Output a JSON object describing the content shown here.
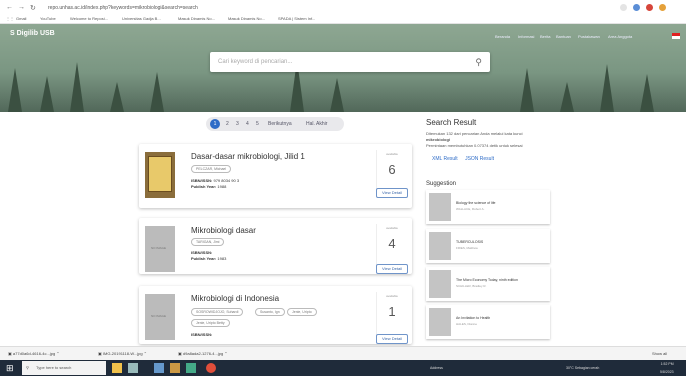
{
  "browser": {
    "url": "repo.unhas.ac.id/index.php?keywords=mikrobiologi&search=search",
    "bookmarks": [
      "Gmail",
      "YouTube",
      "Welcome to Reposi...",
      "Universitas Gadja B...",
      "Masuk Dinamis No...",
      "Masuk Dinamis No...",
      "SPADA | Sistem Inf..."
    ]
  },
  "site": {
    "logo": "Digilib USB",
    "nav": [
      "Beranda",
      "Informasi",
      "Berita",
      "Bantuan",
      "Pustakawan",
      "Area Anggota"
    ],
    "search_placeholder": "Cari keyword di pencarian..."
  },
  "pagination": {
    "pages": [
      "1",
      "2",
      "3",
      "4",
      "5"
    ],
    "next_label": "Berikutnya",
    "last_label": "Hal. Akhir"
  },
  "results": [
    {
      "title": "Dasar-dasar mikrobiologi, Jilid 1",
      "authors": [
        "PELCZAR, Michael"
      ],
      "isbn_label": "ISBN/ISSN:",
      "isbn": "979 8034 90 3",
      "year_label": "Publish Year:",
      "year": "1988",
      "count_label": "available",
      "count": "6",
      "detail_label": "View Detail"
    },
    {
      "title": "Mikrobiologi dasar",
      "authors": [
        "TARIGAN, Jimi"
      ],
      "isbn_label": "ISBN/ISSN:",
      "isbn": "",
      "year_label": "Publish Year:",
      "year": "1983",
      "count_label": "available",
      "count": "4",
      "detail_label": "View Detail"
    },
    {
      "title": "Mikrobiologi di Indonesia",
      "authors": [
        "SOSROWIDJOJO, Suhardi",
        "Susanto, Ign",
        "Jenie, Uripto",
        "Jenie, Uripto Betty"
      ],
      "isbn_label": "ISBN/ISSN:",
      "isbn": "",
      "year_label": "",
      "year": "",
      "count_label": "available",
      "count": "1",
      "detail_label": "View Detail"
    }
  ],
  "sidebar": {
    "result_heading": "Search Result",
    "summary_1": "Ditemukan 132 dari pencarian Anda melalui kata kunci",
    "keyword": "mikrobiologi",
    "summary_2": "Permintaan membutuhkan 0.07374 detik untuk selesai",
    "xml_label": "XML Result",
    "json_label": "JSON Result",
    "suggestion_heading": "Suggestion",
    "suggestions": [
      {
        "title": "Biology the science of life",
        "author": "WALLACE, Robert A."
      },
      {
        "title": "TUBERCULOSIS",
        "author": "FRIES, Matthew"
      },
      {
        "title": "The Micro Economy Today, ninth edition",
        "author": "SCHILLER, Bradley R."
      },
      {
        "title": "An Invitation to Health",
        "author": "HALES, Dianne"
      }
    ]
  },
  "downloads": {
    "items": [
      "a77d0a6d-4616-4c...jpg",
      "IMG-20191118-W...jpg",
      "d9a8ada2-1276-4...jpg"
    ],
    "show_all": "Show all"
  },
  "taskbar": {
    "search_placeholder": "Type here to search",
    "address_label": "Address",
    "weather": "30°C Sebagian cerah",
    "time": "1:52 PM",
    "date": "5/8/2023"
  },
  "colors": {
    "accent": "#2e6cc7",
    "hero": "#7a9682",
    "taskbar": "#1f2b3a"
  }
}
